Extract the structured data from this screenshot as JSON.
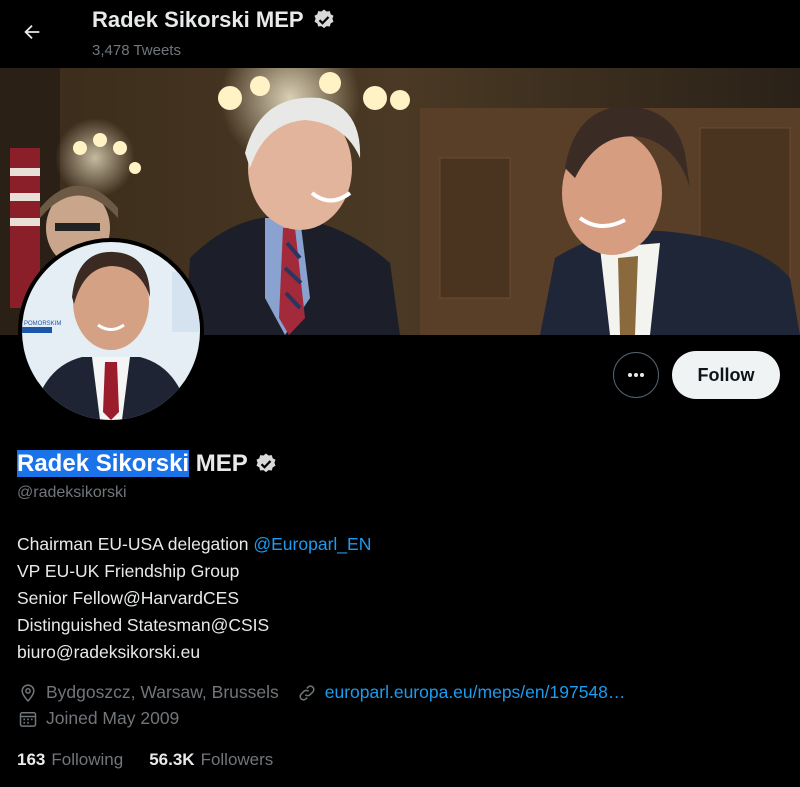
{
  "header": {
    "name": "Radek Sikorski MEP",
    "tweet_count": "3,478 Tweets"
  },
  "profile": {
    "name_highlighted": "Radek Sikorski",
    "name_suffix": " MEP",
    "handle": "@radeksikorski",
    "follow_label": "Follow",
    "bio": {
      "line1_text": "Chairman EU-USA delegation ",
      "line1_mention": "@Europarl_EN",
      "line2": "VP EU-UK Friendship Group",
      "line3": "Senior Fellow@HarvardCES",
      "line4": "Distinguished Statesman@CSIS",
      "line5": "biuro@radeksikorski.eu"
    },
    "location": "Bydgoszcz, Warsaw, Brussels",
    "website": "europarl.europa.eu/meps/en/197548…",
    "joined": "Joined May 2009",
    "following_count": "163",
    "following_label": "Following",
    "followers_count": "56.3K",
    "followers_label": "Followers"
  },
  "colors": {
    "background": "#000000",
    "primary_text": "#e7e9ea",
    "secondary_text": "#71767b",
    "link": "#1d9bf0",
    "verified_badge": "#d9d9d9",
    "selection": "#1a73e8"
  }
}
